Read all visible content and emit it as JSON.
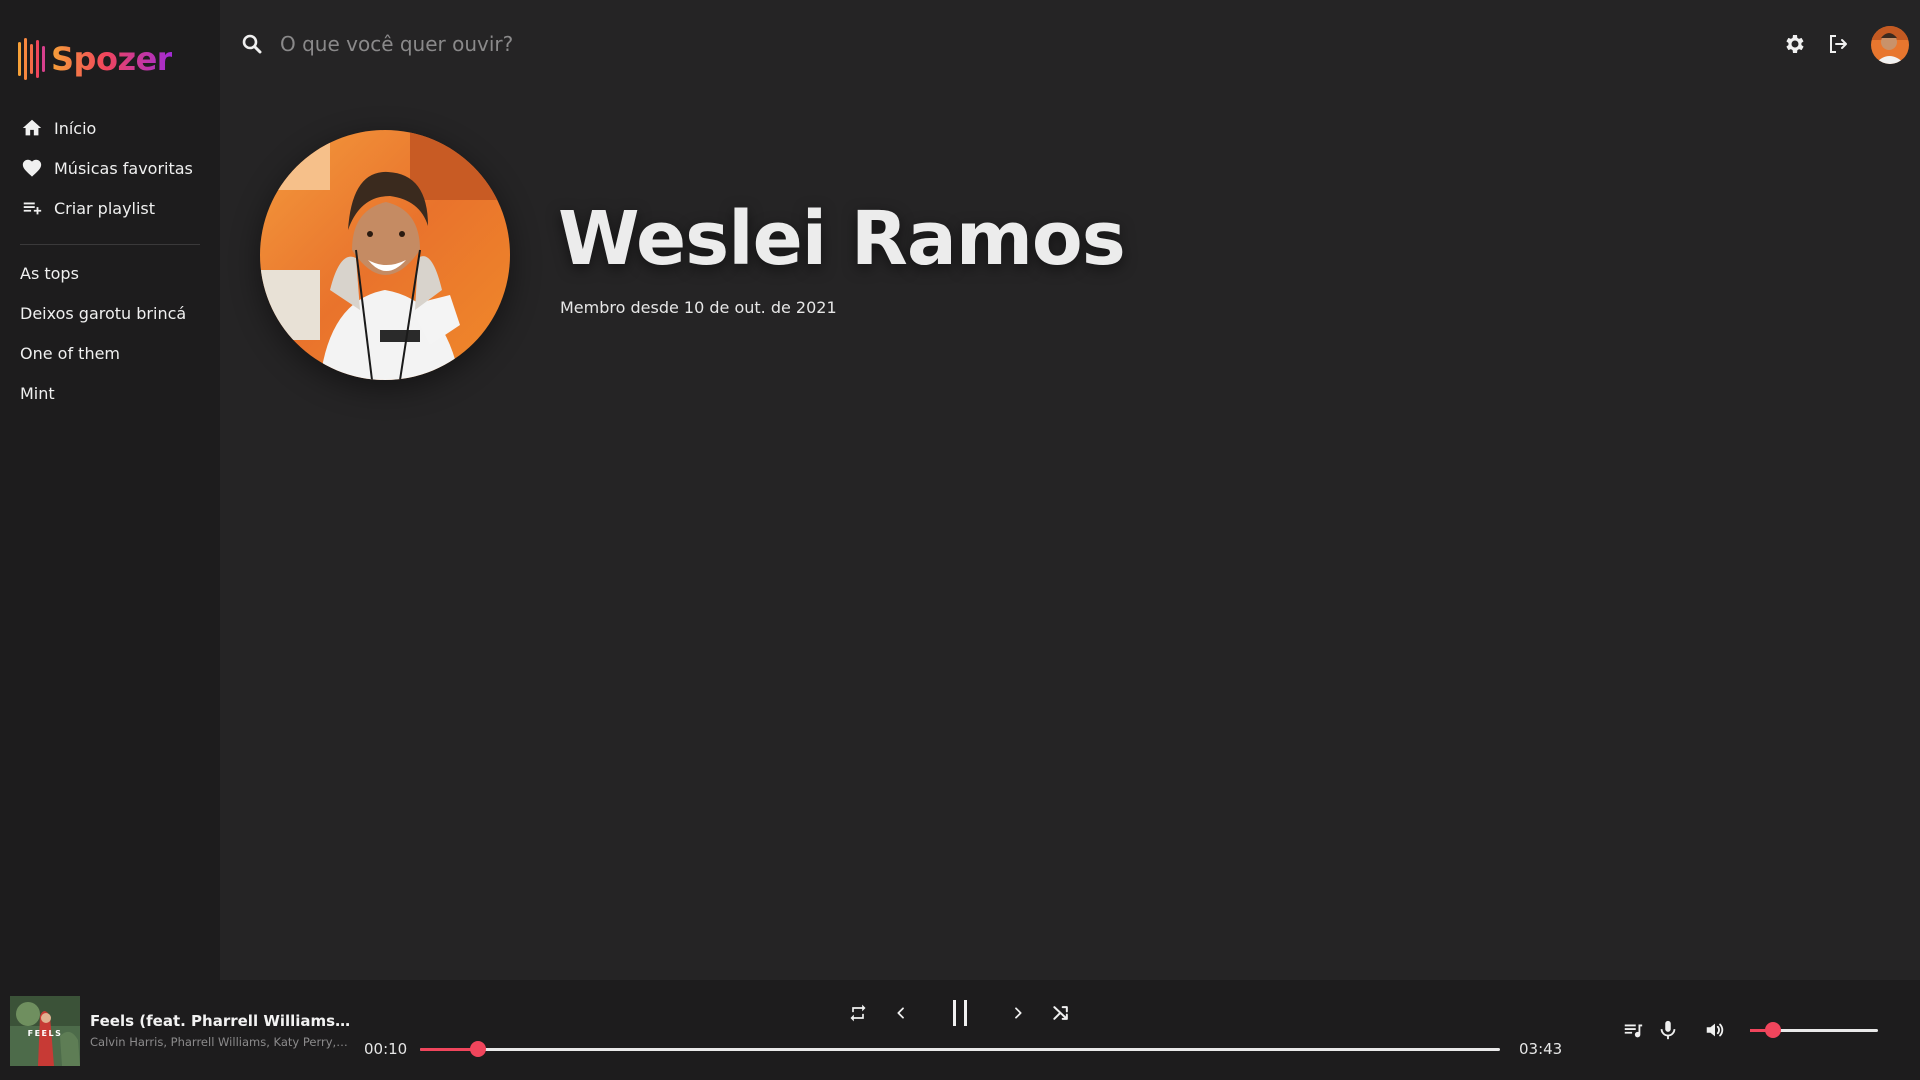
{
  "app": {
    "name": "Spozer"
  },
  "sidebar": {
    "nav": [
      {
        "label": "Início",
        "icon": "home-icon"
      },
      {
        "label": "Músicas favoritas",
        "icon": "heart-icon"
      },
      {
        "label": "Criar playlist",
        "icon": "playlist-add-icon"
      }
    ],
    "playlists": [
      "As tops",
      "Deixos garotu brincá",
      "One of them",
      "Mint"
    ]
  },
  "search": {
    "placeholder": "O que você quer ouvir?",
    "value": ""
  },
  "header": {
    "icons": [
      "gear-icon",
      "logout-icon",
      "avatar"
    ]
  },
  "profile": {
    "name": "Weslei Ramos",
    "member_since": "Membro desde 10 de out. de 2021"
  },
  "player": {
    "track_title": "Feels (feat. Pharrell Williams, Katy Perry & Big Sean)",
    "track_artist": "Calvin Harris, Pharrell Williams, Katy Perry, Big Sean",
    "album_art_text": "FEELS",
    "current_time": "00:10",
    "total_time": "03:43",
    "progress": 0.054,
    "volume": 0.18,
    "state": "playing"
  },
  "colors": {
    "accent": "#f0455c",
    "background": "#252425",
    "sidebar": "#1d1c1d",
    "logo_gradient": [
      "#f7a138",
      "#f0455c",
      "#a22bd6"
    ]
  }
}
